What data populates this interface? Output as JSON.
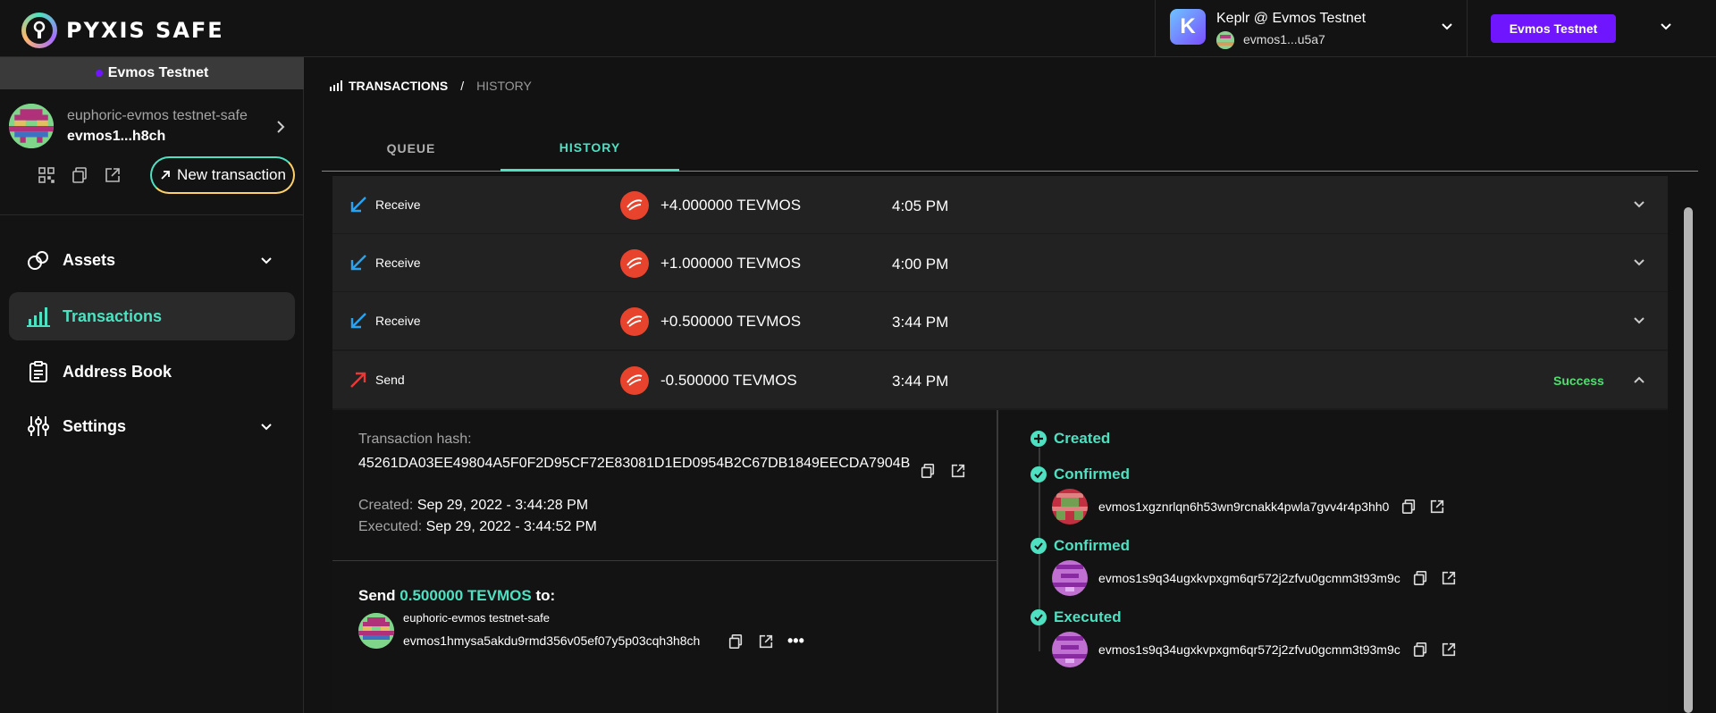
{
  "app": {
    "brand": "PYXIS SAFE"
  },
  "wallet": {
    "name": "Keplr @ Evmos Testnet",
    "address": "evmos1...u5a7",
    "badge_letter": "K"
  },
  "network_button": {
    "label": "Evmos Testnet"
  },
  "sidebar": {
    "network": "Evmos Testnet",
    "safe_name": "euphoric-evmos testnet-safe",
    "safe_address": "evmos1...h8ch",
    "new_transaction_label": "New transaction",
    "nav": [
      {
        "label": "Assets",
        "icon": "assets-icon"
      },
      {
        "label": "Transactions",
        "icon": "transactions-icon"
      },
      {
        "label": "Address Book",
        "icon": "address-book-icon"
      },
      {
        "label": "Settings",
        "icon": "settings-icon"
      }
    ]
  },
  "breadcrumb": {
    "section": "TRANSACTIONS",
    "page": "HISTORY"
  },
  "tabs": [
    {
      "label": "QUEUE"
    },
    {
      "label": "HISTORY"
    }
  ],
  "transactions": [
    {
      "type": "Receive",
      "amount": "+4.000000 TEVMOS",
      "time": "4:05 PM",
      "status": ""
    },
    {
      "type": "Receive",
      "amount": "+1.000000 TEVMOS",
      "time": "4:00 PM",
      "status": ""
    },
    {
      "type": "Receive",
      "amount": "+0.500000 TEVMOS",
      "time": "3:44 PM",
      "status": ""
    },
    {
      "type": "Send",
      "amount": "-0.500000 TEVMOS",
      "time": "3:44 PM",
      "status": "Success"
    }
  ],
  "detail": {
    "hash_label": "Transaction hash:",
    "hash": "45261DA03EE49804A5F0F2D95CF72E83081D1ED0954B2C67DB1849EECDA7904B",
    "created_label": "Created:",
    "created": "Sep 29, 2022 - 3:44:28 PM",
    "executed_label": "Executed:",
    "executed": "Sep 29, 2022 - 3:44:52 PM",
    "send_prefix": "Send",
    "send_amount": "0.500000 TEVMOS",
    "send_suffix": "to:",
    "recipient_name": "euphoric-evmos testnet-safe",
    "recipient_address": "evmos1hmysa5akdu9rmd356v05ef07y5p03cqh3h8ch",
    "more": "•••"
  },
  "timeline": [
    {
      "label": "Created",
      "owner": ""
    },
    {
      "label": "Confirmed",
      "owner": "evmos1xgznrlqn6h53wn9rcnakk4pwla7gvv4r4p3hh0"
    },
    {
      "label": "Confirmed",
      "owner": "evmos1s9q34ugxkvpxgm6qr572j2zfvu0gcmm3t93m9c"
    },
    {
      "label": "Executed",
      "owner": "evmos1s9q34ugxkvpxgm6qr572j2zfvu0gcmm3t93m9c"
    }
  ],
  "colors": {
    "accent": "#4de1c1",
    "brand_purple": "#6f16ff",
    "success": "#4ee06e",
    "evmos_red": "#e8432d"
  }
}
